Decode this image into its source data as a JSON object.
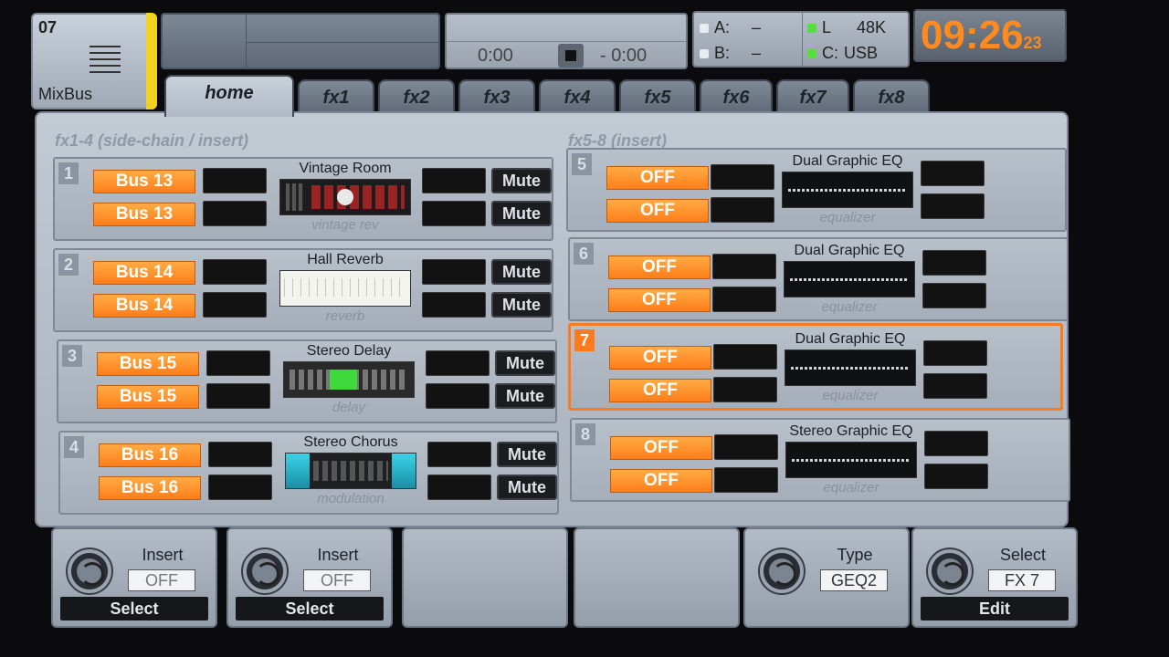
{
  "channel": {
    "number": "07",
    "name": "MixBus"
  },
  "transport": {
    "time_elapsed": "0:00",
    "time_remaining": "- 0:00"
  },
  "io": {
    "a_label": "A:",
    "a_value": "–",
    "b_label": "B:",
    "b_value": "–",
    "l_label": "L",
    "sample_rate": "48K",
    "c_label": "C:",
    "c_value": "USB"
  },
  "clock": {
    "time": "09:26",
    "seconds": "23"
  },
  "tabs": [
    "home",
    "fx1",
    "fx2",
    "fx3",
    "fx4",
    "fx5",
    "fx6",
    "fx7",
    "fx8"
  ],
  "groups": {
    "left": "fx1-4 (side-chain / insert)",
    "right": "fx5-8 (insert)"
  },
  "mute_label": "Mute",
  "slots": [
    {
      "num": "1",
      "src1": "Bus 13",
      "src2": "Bus 13",
      "fx_name": "Vintage Room",
      "fx_type": "vintage rev"
    },
    {
      "num": "2",
      "src1": "Bus 14",
      "src2": "Bus 14",
      "fx_name": "Hall Reverb",
      "fx_type": "reverb"
    },
    {
      "num": "3",
      "src1": "Bus 15",
      "src2": "Bus 15",
      "fx_name": "Stereo Delay",
      "fx_type": "delay"
    },
    {
      "num": "4",
      "src1": "Bus 16",
      "src2": "Bus 16",
      "fx_name": "Stereo Chorus",
      "fx_type": "modulation"
    },
    {
      "num": "5",
      "src1": "OFF",
      "src2": "OFF",
      "fx_name": "Dual Graphic EQ",
      "fx_type": "equalizer"
    },
    {
      "num": "6",
      "src1": "OFF",
      "src2": "OFF",
      "fx_name": "Dual Graphic EQ",
      "fx_type": "equalizer"
    },
    {
      "num": "7",
      "src1": "OFF",
      "src2": "OFF",
      "fx_name": "Dual Graphic EQ",
      "fx_type": "equalizer"
    },
    {
      "num": "8",
      "src1": "OFF",
      "src2": "OFF",
      "fx_name": "Stereo Graphic EQ",
      "fx_type": "equalizer"
    }
  ],
  "encoders": [
    {
      "label": "Insert",
      "value": "OFF",
      "button": "Select"
    },
    {
      "label": "Insert",
      "value": "OFF",
      "button": "Select"
    },
    {
      "label": "",
      "value": "",
      "button": ""
    },
    {
      "label": "",
      "value": "",
      "button": ""
    },
    {
      "label": "Type",
      "value": "GEQ2",
      "button": ""
    },
    {
      "label": "Select",
      "value": "FX 7",
      "button": "Edit"
    }
  ],
  "colors": {
    "accent": "#ff7e1a",
    "selected_border": "#ff7a1c",
    "led_on": "#53e03c",
    "clock": "#ff8a1e"
  }
}
